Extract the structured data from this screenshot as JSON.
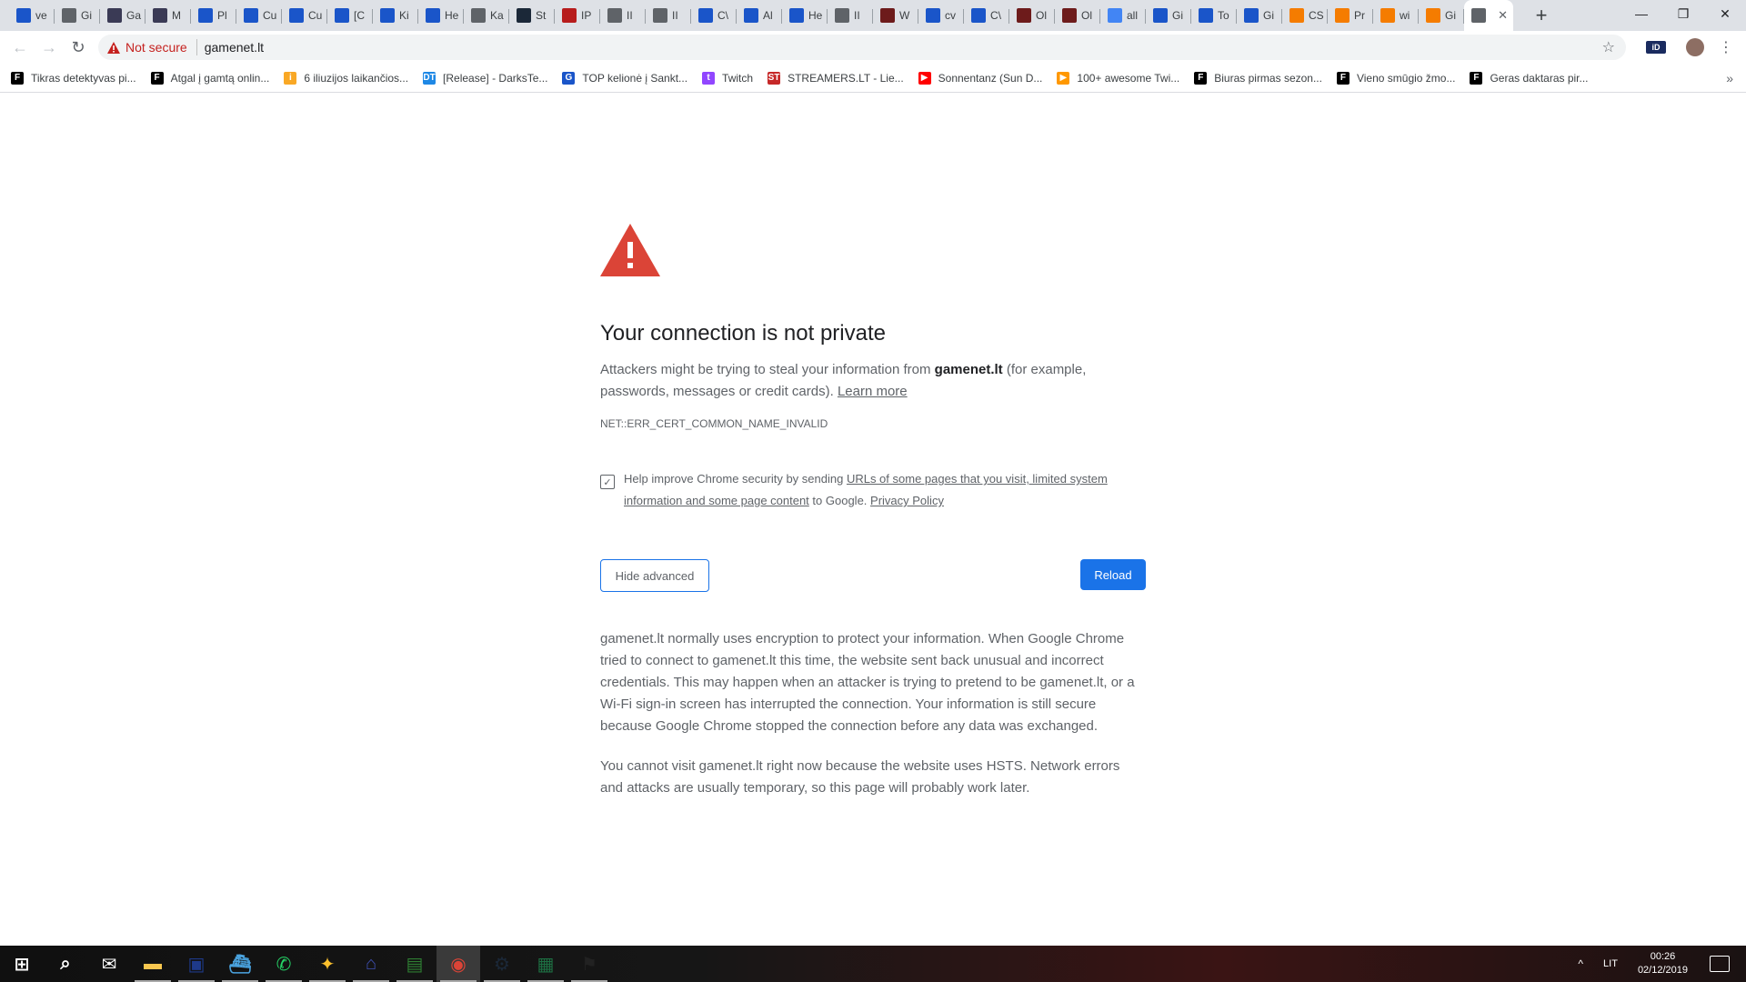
{
  "tabs": [
    {
      "label": "ve",
      "icon": "bookmark-blue-icon",
      "color": "#1a55c9"
    },
    {
      "label": "Gi",
      "icon": "globe-icon",
      "color": "#5f6368"
    },
    {
      "label": "Ga",
      "icon": "x-logo-icon",
      "color": "#3a3a55"
    },
    {
      "label": "M",
      "icon": "x-logo-icon",
      "color": "#3a3a55"
    },
    {
      "label": "Pl",
      "icon": "bookmark-blue-icon",
      "color": "#1a55c9"
    },
    {
      "label": "Cu",
      "icon": "bookmark-blue-icon",
      "color": "#1a55c9"
    },
    {
      "label": "Cu",
      "icon": "bookmark-blue-icon",
      "color": "#1a55c9"
    },
    {
      "label": "[C",
      "icon": "bookmark-blue-icon",
      "color": "#1a55c9"
    },
    {
      "label": "Ki",
      "icon": "bookmark-blue-icon",
      "color": "#1a55c9"
    },
    {
      "label": "He",
      "icon": "bookmark-blue-icon",
      "color": "#1a55c9"
    },
    {
      "label": "Ka",
      "icon": "globe-icon",
      "color": "#5f6368"
    },
    {
      "label": "St",
      "icon": "steam-icon",
      "color": "#1b2838"
    },
    {
      "label": "IP",
      "icon": "bug-icon",
      "color": "#b71c1c"
    },
    {
      "label": "II",
      "icon": "globe-icon",
      "color": "#5f6368"
    },
    {
      "label": "II",
      "icon": "globe-icon",
      "color": "#5f6368"
    },
    {
      "label": "C\\",
      "icon": "bookmark-blue-icon",
      "color": "#1a55c9"
    },
    {
      "label": "Al",
      "icon": "bookmark-blue-icon",
      "color": "#1a55c9"
    },
    {
      "label": "He",
      "icon": "bookmark-blue-icon",
      "color": "#1a55c9"
    },
    {
      "label": "II",
      "icon": "globe-icon",
      "color": "#5f6368"
    },
    {
      "label": "W",
      "icon": "game-icon",
      "color": "#6d1b1b"
    },
    {
      "label": "cv",
      "icon": "bookmark-blue-icon",
      "color": "#1a55c9"
    },
    {
      "label": "C\\",
      "icon": "bookmark-blue-icon",
      "color": "#1a55c9"
    },
    {
      "label": "Ol",
      "icon": "game-icon",
      "color": "#6d1b1b"
    },
    {
      "label": "Ol",
      "icon": "game-icon",
      "color": "#6d1b1b"
    },
    {
      "label": "all",
      "icon": "google-icon",
      "color": "#4285f4"
    },
    {
      "label": "Gi",
      "icon": "bookmark-blue-icon",
      "color": "#1a55c9"
    },
    {
      "label": "To",
      "icon": "bookmark-blue-icon",
      "color": "#1a55c9"
    },
    {
      "label": "Gi",
      "icon": "bookmark-blue-icon",
      "color": "#1a55c9"
    },
    {
      "label": "CS",
      "icon": "orange-icon",
      "color": "#f57c00"
    },
    {
      "label": "Pr",
      "icon": "orange-icon",
      "color": "#f57c00"
    },
    {
      "label": "wi",
      "icon": "orange-icon",
      "color": "#f57c00"
    },
    {
      "label": "Gi",
      "icon": "orange-icon",
      "color": "#f57c00"
    },
    {
      "label": "",
      "icon": "globe-icon",
      "color": "#5f6368",
      "active": true
    }
  ],
  "window": {
    "minimize": "—",
    "restore": "❐",
    "close": "✕",
    "new_tab": "+"
  },
  "toolbar": {
    "back": "←",
    "forward": "→",
    "reload": "↻",
    "security_label": "Not secure",
    "url": "gamenet.lt",
    "star": "☆",
    "ext_label": "iD",
    "menu": "⋮"
  },
  "bookmarks": [
    {
      "label": "Tikras detektyvas pi...",
      "icon": "f-icon",
      "color": "#000000",
      "glyph": "F"
    },
    {
      "label": "Atgal į gamtą onlin...",
      "icon": "f-icon",
      "color": "#000000",
      "glyph": "F"
    },
    {
      "label": "6 iliuzijos laikančios...",
      "icon": "info-icon",
      "color": "#f9a825",
      "glyph": "i"
    },
    {
      "label": "[Release] - DarksTe...",
      "icon": "dt-icon",
      "color": "#1e88e5",
      "glyph": "DT"
    },
    {
      "label": "TOP kelionė į Sankt...",
      "icon": "g-icon",
      "color": "#1a55c9",
      "glyph": "G"
    },
    {
      "label": "Twitch",
      "icon": "twitch-icon",
      "color": "#9146ff",
      "glyph": "t"
    },
    {
      "label": "STREAMERS.LT - Lie...",
      "icon": "st-icon",
      "color": "#c62828",
      "glyph": "ST"
    },
    {
      "label": "Sonnentanz (Sun D...",
      "icon": "youtube-icon",
      "color": "#ff0000",
      "glyph": "▶"
    },
    {
      "label": "100+ awesome Twi...",
      "icon": "play-icon",
      "color": "#ff9800",
      "glyph": "▶"
    },
    {
      "label": "Biuras pirmas sezon...",
      "icon": "f-icon",
      "color": "#000000",
      "glyph": "F"
    },
    {
      "label": "Vieno smūgio žmo...",
      "icon": "f-icon",
      "color": "#000000",
      "glyph": "F"
    },
    {
      "label": "Geras daktaras pir...",
      "icon": "f-icon",
      "color": "#000000",
      "glyph": "F"
    }
  ],
  "bookmarks_more": "»",
  "interstitial": {
    "heading": "Your connection is not private",
    "p1_before": "Attackers might be trying to steal your information from ",
    "p1_domain": "gamenet.lt",
    "p1_after": " (for example, passwords, messages or credit cards). ",
    "learn_more": "Learn more",
    "error_code": "NET::ERR_CERT_COMMON_NAME_INVALID",
    "optin_before": "Help improve Chrome security by sending ",
    "optin_link": "URLs of some pages that you visit, limited system information and some page content",
    "optin_middle": " to Google. ",
    "privacy_policy": "Privacy Policy",
    "optin_checked": "✓",
    "hide_advanced": "Hide advanced",
    "reload": "Reload",
    "details_1": "gamenet.lt normally uses encryption to protect your information. When Google Chrome tried to connect to gamenet.lt this time, the website sent back unusual and incorrect credentials. This may happen when an attacker is trying to pretend to be gamenet.lt, or a Wi-Fi sign-in screen has interrupted the connection. Your information is still secure because Google Chrome stopped the connection before any data was exchanged.",
    "details_2": "You cannot visit gamenet.lt right now because the website uses HSTS. Network errors and attacks are usually temporary, so this page will probably work later."
  },
  "taskbar": {
    "items": [
      {
        "name": "windows-start-icon",
        "color": "#ffffff",
        "glyph": "⊞"
      },
      {
        "name": "search-icon",
        "color": "#ffffff",
        "glyph": "⌕"
      },
      {
        "name": "mail-icon",
        "color": "#ffffff",
        "glyph": "✉"
      },
      {
        "name": "file-explorer-icon",
        "color": "#f9c74f",
        "glyph": "▬"
      },
      {
        "name": "app-blue-icon",
        "color": "#1e3a8a",
        "glyph": "▣"
      },
      {
        "name": "app-ship-icon",
        "color": "#4aa3df",
        "glyph": "⛴"
      },
      {
        "name": "whatsapp-icon",
        "color": "#25d366",
        "glyph": "✆"
      },
      {
        "name": "app-yellow-icon",
        "color": "#fbc02d",
        "glyph": "✦"
      },
      {
        "name": "app-network-icon",
        "color": "#3f51b5",
        "glyph": "⌂"
      },
      {
        "name": "app-green-icon",
        "color": "#2e7d32",
        "glyph": "▤"
      },
      {
        "name": "chrome-icon",
        "color": "#db4437",
        "glyph": "◉",
        "active": true
      },
      {
        "name": "steam-icon",
        "color": "#1b2838",
        "glyph": "⚙"
      },
      {
        "name": "spreadsheet-icon",
        "color": "#1d6f42",
        "glyph": "▦"
      },
      {
        "name": "counter-strike-icon",
        "color": "#222222",
        "glyph": "⚑"
      }
    ],
    "tray_chevron": "^",
    "language": "LIT",
    "time": "00:26",
    "date": "02/12/2019"
  }
}
